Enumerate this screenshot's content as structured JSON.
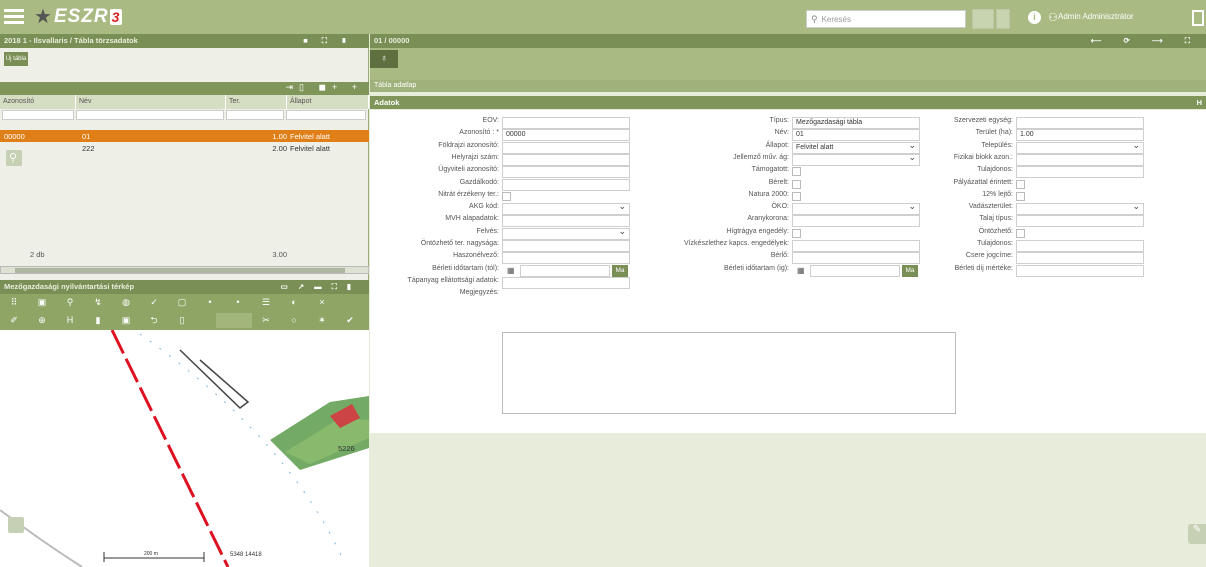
{
  "header": {
    "logo_text": "ESZR",
    "logo_version": "3",
    "search_placeholder": "Keresés",
    "user": "Admin Adminisztrátor"
  },
  "left_panel": {
    "title": "2018 1 - Ilsvallaris / Tábla törzsadatok",
    "new_button": "Új tábla",
    "columns": [
      "Azonosító",
      "Név",
      "Ter.",
      "Állapot"
    ],
    "rows": [
      {
        "id": "00000",
        "name": "01",
        "area": "1.00",
        "status": "Felvitel alatt"
      },
      {
        "id": "",
        "name": "222",
        "area": "2.00",
        "status": "Felvitel alatt"
      }
    ],
    "summary": {
      "count": "2 db",
      "area": "3.00"
    }
  },
  "map_panel": {
    "title": "Mezőgazdasági nyilvántartási térkép",
    "scale": "200 m",
    "coords": "5348 14418",
    "label": "5226"
  },
  "right_panel": {
    "title": "01 / 00000",
    "sub_header": "Tábla adatlap",
    "section": "Adatok"
  },
  "form": {
    "col1": [
      {
        "l": "EOV:",
        "v": ""
      },
      {
        "l": "Azonosító : *",
        "v": "00000"
      },
      {
        "l": "Földrajzi azonosító:",
        "v": ""
      },
      {
        "l": "Helyrajzi szám:",
        "v": ""
      },
      {
        "l": "Ügyviteli azonosító:",
        "v": ""
      },
      {
        "l": "Gazdálkodó:",
        "v": ""
      },
      {
        "l": "Nitrát érzékeny ter.:",
        "v": ""
      },
      {
        "l": "AKG kód:",
        "v": ""
      },
      {
        "l": "MVH alapadatok:",
        "v": ""
      },
      {
        "l": "Felvés:",
        "v": ""
      },
      {
        "l": "Öntözhető ter. nagysága:",
        "v": ""
      },
      {
        "l": "Haszonélvező:",
        "v": ""
      },
      {
        "l": "Bérleti időtartam (tól):",
        "v": ""
      },
      {
        "l": "Tápanyag ellátottsági adatok:",
        "v": ""
      },
      {
        "l": "Megjegyzés:",
        "v": ""
      }
    ],
    "col2": [
      {
        "l": "Típus:",
        "v": "Mezőgazdasági tábla"
      },
      {
        "l": "Név:",
        "v": "01"
      },
      {
        "l": "Állapot:",
        "v": "Felvitel alatt"
      },
      {
        "l": "Jellemző műv. ág:",
        "v": ""
      },
      {
        "l": "Támogatott:",
        "v": ""
      },
      {
        "l": "Bérelt:",
        "v": ""
      },
      {
        "l": "Natura 2000:",
        "v": ""
      },
      {
        "l": "ÖKO:",
        "v": ""
      },
      {
        "l": "Aranykorona:",
        "v": ""
      },
      {
        "l": "Hígtrágya engedély:",
        "v": ""
      },
      {
        "l": "Vízkészlethez kapcs. engedélyek:",
        "v": ""
      },
      {
        "l": "Bérlő:",
        "v": ""
      },
      {
        "l": "Bérleti időtartam (ig):",
        "v": ""
      }
    ],
    "col3": [
      {
        "l": "Szervezeti egység:",
        "v": ""
      },
      {
        "l": "Terület (ha):",
        "v": "1.00"
      },
      {
        "l": "Település:",
        "v": ""
      },
      {
        "l": "Fizikai blokk azon.:",
        "v": ""
      },
      {
        "l": "Tulajdonos:",
        "v": ""
      },
      {
        "l": "Pályázattal érintett:",
        "v": ""
      },
      {
        "l": "12% lejtő:",
        "v": ""
      },
      {
        "l": "Vadászterület:",
        "v": ""
      },
      {
        "l": "Talaj típus:",
        "v": ""
      },
      {
        "l": "Öntözhető:",
        "v": ""
      },
      {
        "l": "Tulajdonos:",
        "v": ""
      },
      {
        "l": "Csere jogcíme:",
        "v": ""
      },
      {
        "l": "Bérleti díj mértéke:",
        "v": ""
      }
    ],
    "ma_label": "Ma"
  }
}
